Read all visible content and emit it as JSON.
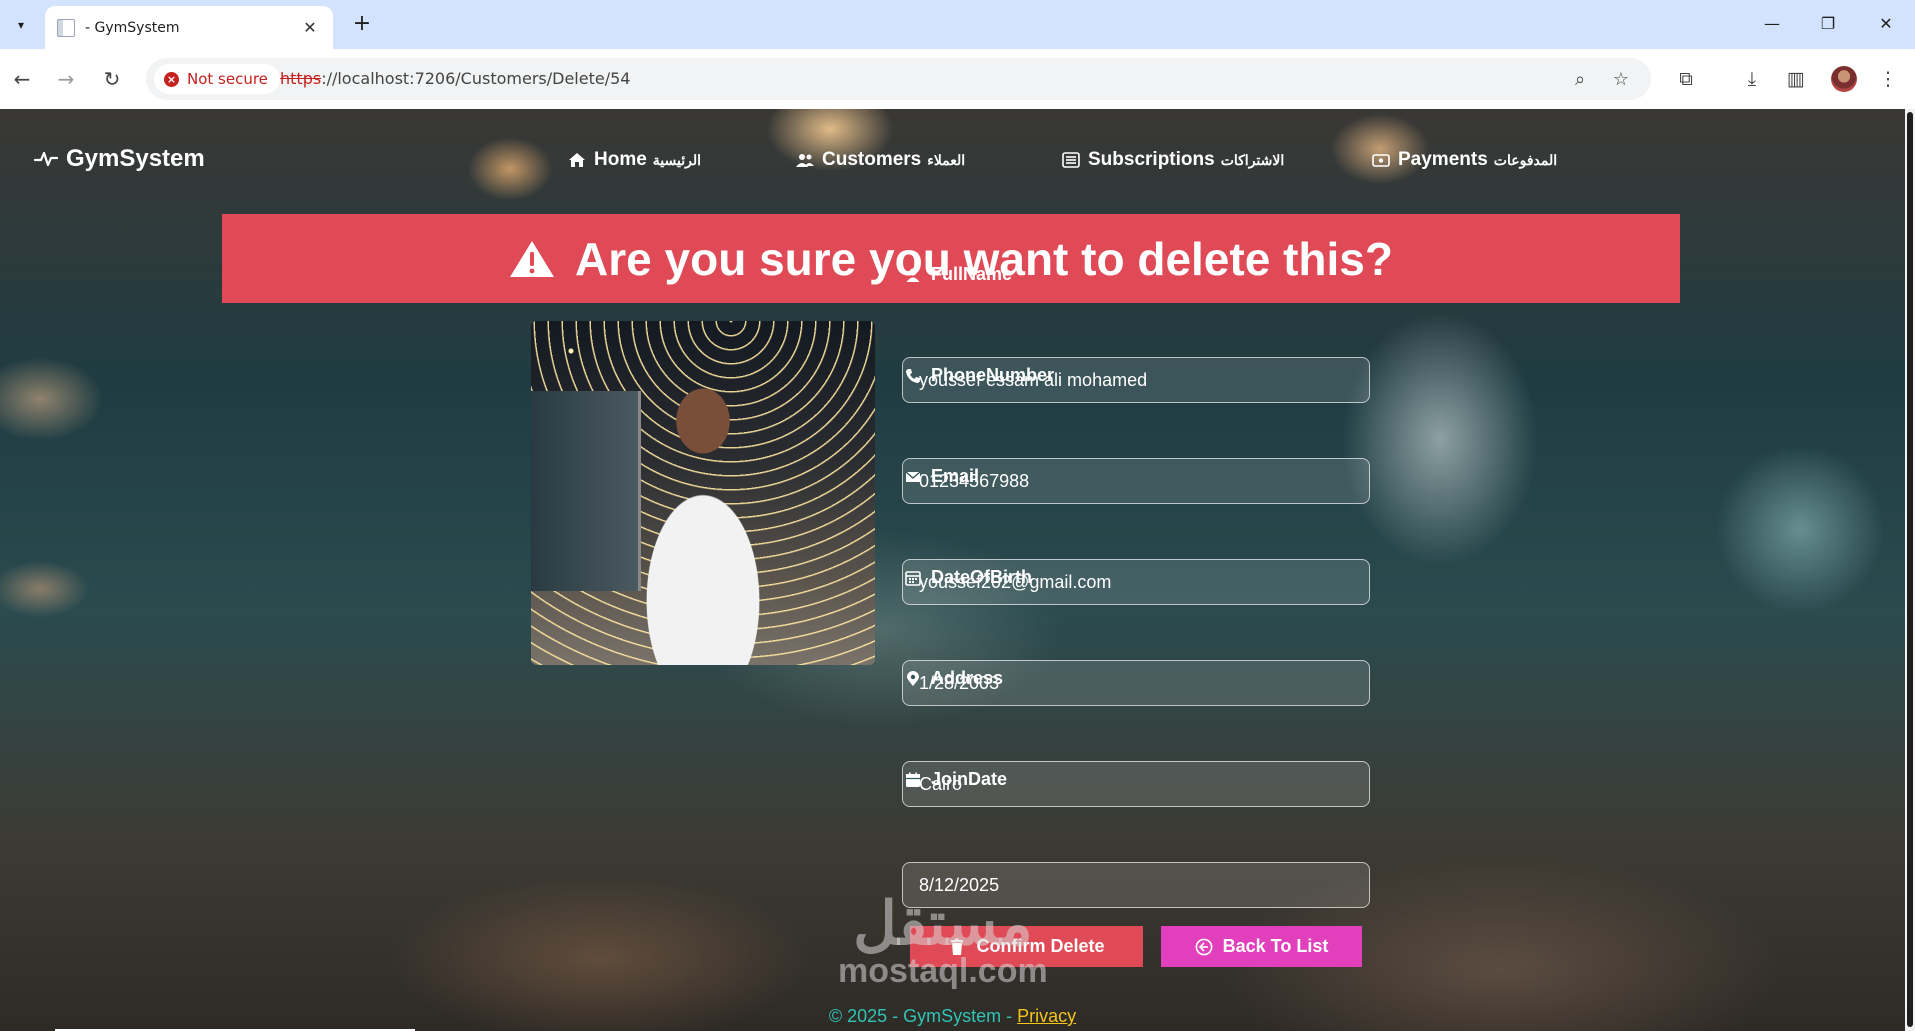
{
  "browser": {
    "tab_title": "- GymSystem",
    "new_tab": "+",
    "security_label": "Not secure",
    "url_scheme": "https",
    "url_rest": "://localhost:7206/Customers/Delete/54"
  },
  "navbar": {
    "brand": "GymSystem",
    "links": [
      {
        "label": "Home",
        "arabic": "الرئيسية",
        "icon": "home-icon"
      },
      {
        "label": "Customers",
        "arabic": "العملاء",
        "icon": "users-icon"
      },
      {
        "label": "Subscriptions",
        "arabic": "الاشتراكات",
        "icon": "list-icon"
      },
      {
        "label": "Payments",
        "arabic": "المدفوعات",
        "icon": "wallet-icon"
      }
    ]
  },
  "alert": {
    "text": "Are you sure you want to delete this?",
    "color": "#e04a56"
  },
  "customer": {
    "fields": [
      {
        "label": "FullName",
        "value": "youssef essam ali mohamed",
        "icon": "person-icon"
      },
      {
        "label": "PhoneNumber",
        "value": "01234567988",
        "icon": "phone-icon"
      },
      {
        "label": "Email",
        "value": "youssef202@gmail.com",
        "icon": "envelope-icon"
      },
      {
        "label": "DateOfBirth",
        "value": "1/28/2003",
        "icon": "calendar-grid-icon"
      },
      {
        "label": "Address",
        "value": "Cairo",
        "icon": "location-pin-icon"
      },
      {
        "label": "JoinDate",
        "value": "8/12/2025",
        "icon": "calendar-icon"
      }
    ]
  },
  "actions": {
    "confirm_delete": "Confirm Delete",
    "back_to_list": "Back To List",
    "delete_color": "#e04a56",
    "back_color": "#e23fbc"
  },
  "watermark": {
    "arabic": "مستقل",
    "latin": "mostaql.com"
  },
  "footer": {
    "text": "© 2025 - GymSystem - ",
    "privacy": "Privacy"
  }
}
